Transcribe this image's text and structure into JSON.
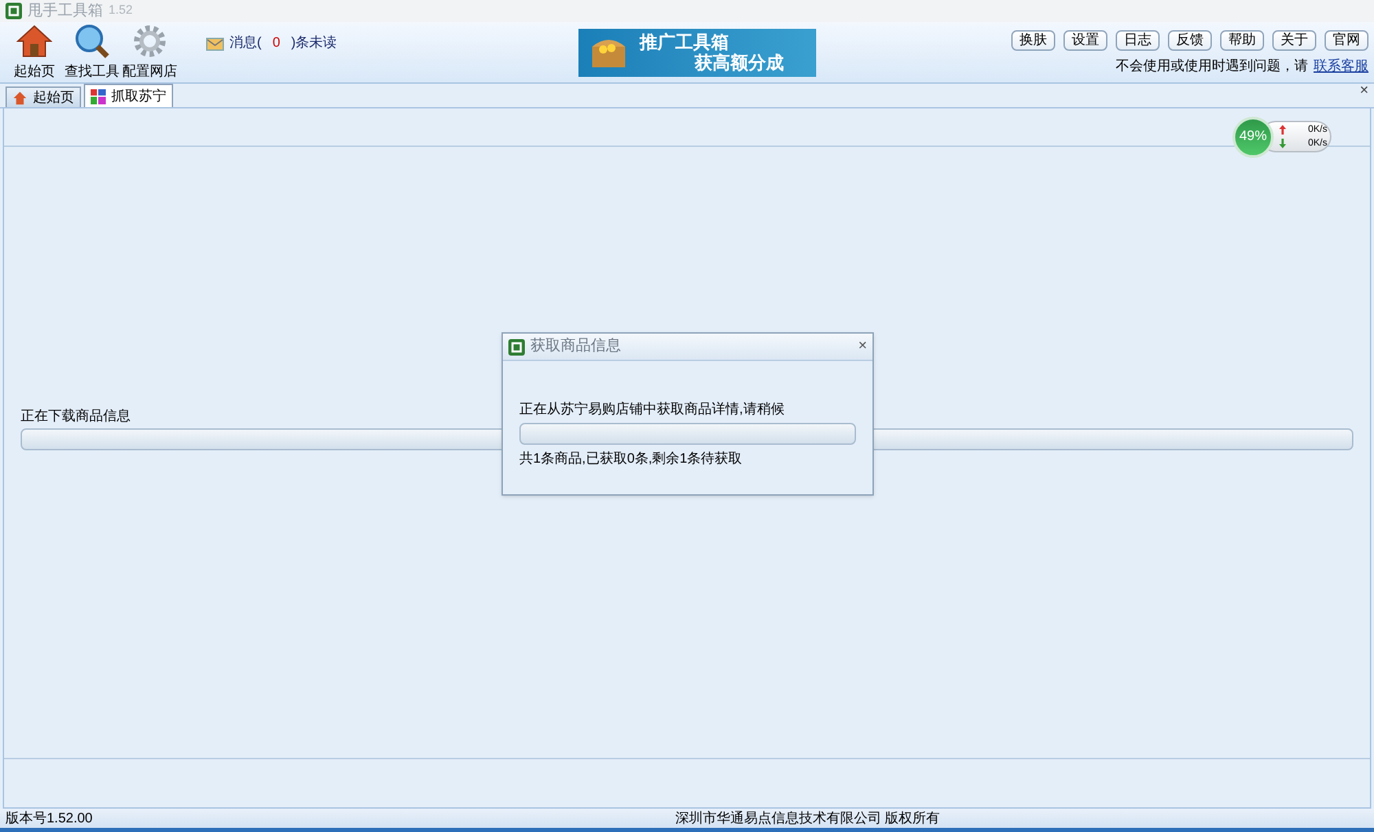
{
  "window": {
    "title": "甩手工具箱",
    "version": "1.52"
  },
  "toolbar": [
    {
      "label": "起始页",
      "kind": "home"
    },
    {
      "label": "查找工具",
      "kind": "search"
    },
    {
      "label": "配置网店",
      "kind": "gear"
    }
  ],
  "messages": {
    "prefix": "消息(",
    "count": "0",
    "suffix": ")条未读"
  },
  "banner": {
    "line1": "推广工具箱",
    "line2": "获高额分成"
  },
  "top_buttons": [
    "换肤",
    "设置",
    "日志",
    "反馈",
    "帮助",
    "关于",
    "官网"
  ],
  "help": {
    "text": "不会使用或使用时遇到问题，请",
    "link": "联系客服"
  },
  "tabs": [
    {
      "label": "起始页",
      "kind": "home",
      "selected": false
    },
    {
      "label": "抓取苏宁",
      "kind": "grid",
      "selected": true
    }
  ],
  "tab_close": "×",
  "speed_widget": {
    "percent": "49%",
    "up": "0K/s",
    "down": "0K/s"
  },
  "download": {
    "label": "正在下载商品信息",
    "level": 0
  },
  "dialog": {
    "title": "获取商品信息",
    "close": "×",
    "message": "正在从苏宁易购店铺中获取商品详情,请稍候",
    "level": 0,
    "summary": "共1条商品,已获取0条,剩余1条待获取"
  },
  "status_bar": {
    "version": "版本号1.52.00",
    "copyright": "深圳市华通易点信息技术有限公司 版权所有"
  }
}
